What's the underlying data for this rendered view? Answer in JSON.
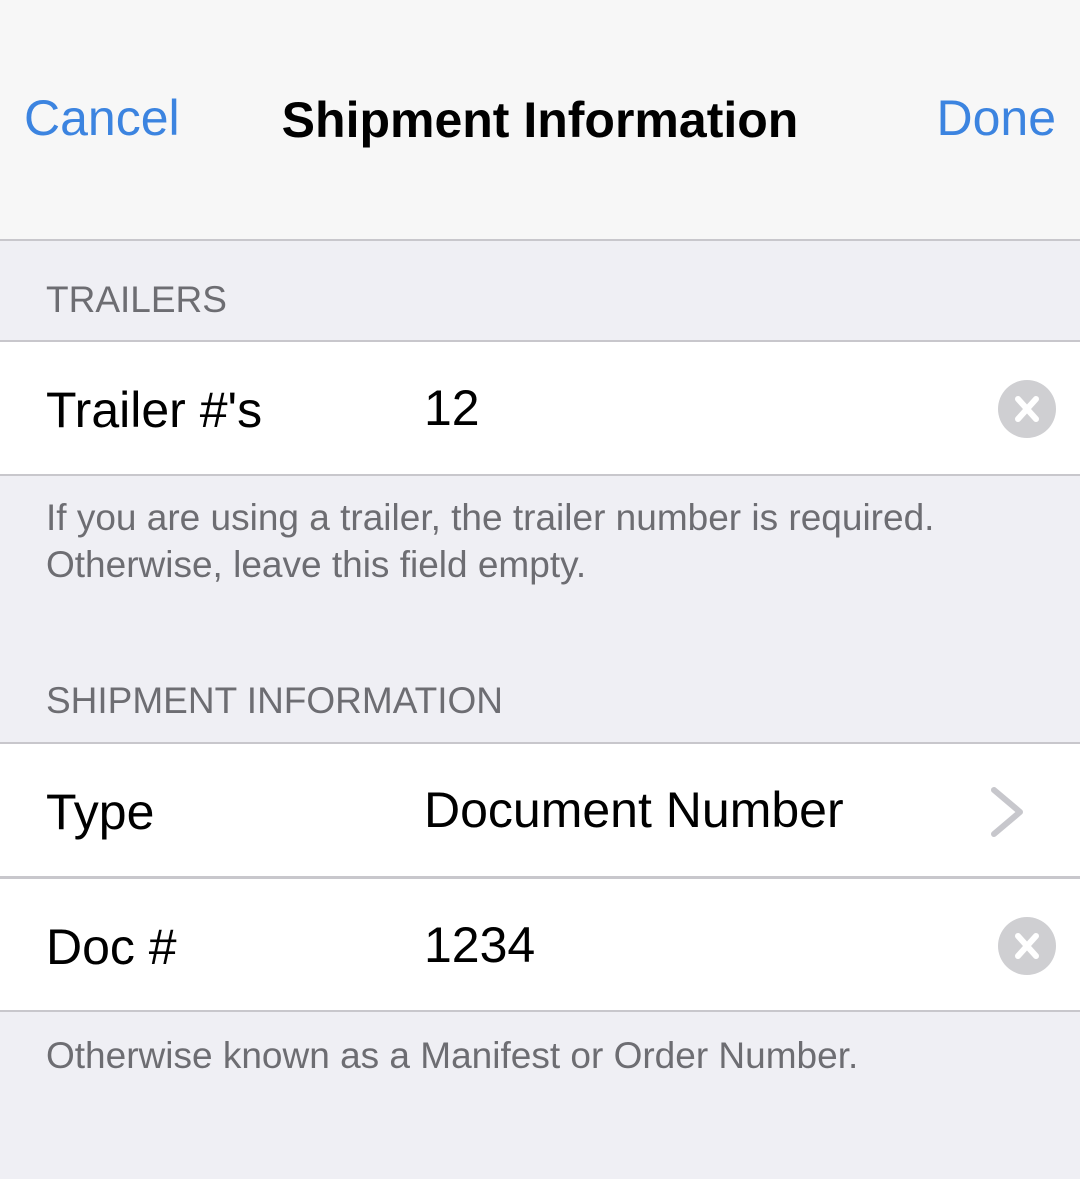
{
  "navbar": {
    "cancel_label": "Cancel",
    "title": "Shipment Information",
    "done_label": "Done",
    "accent_color": "#3c84e0"
  },
  "trailers_section": {
    "header": "TRAILERS",
    "field": {
      "label": "Trailer #'s",
      "value": "12",
      "clear_icon": "clear-circle-icon"
    },
    "footer": "If you are using a trailer, the trailer number is required. Otherwise, leave this field empty."
  },
  "shipment_section": {
    "header": "SHIPMENT INFORMATION",
    "type_row": {
      "label": "Type",
      "value": "Document Number",
      "chevron_icon": "chevron-right-icon"
    },
    "doc_row": {
      "label": "Doc #",
      "value": "1234",
      "clear_icon": "clear-circle-icon"
    },
    "footer": "Otherwise known as a Manifest or Order Number."
  }
}
